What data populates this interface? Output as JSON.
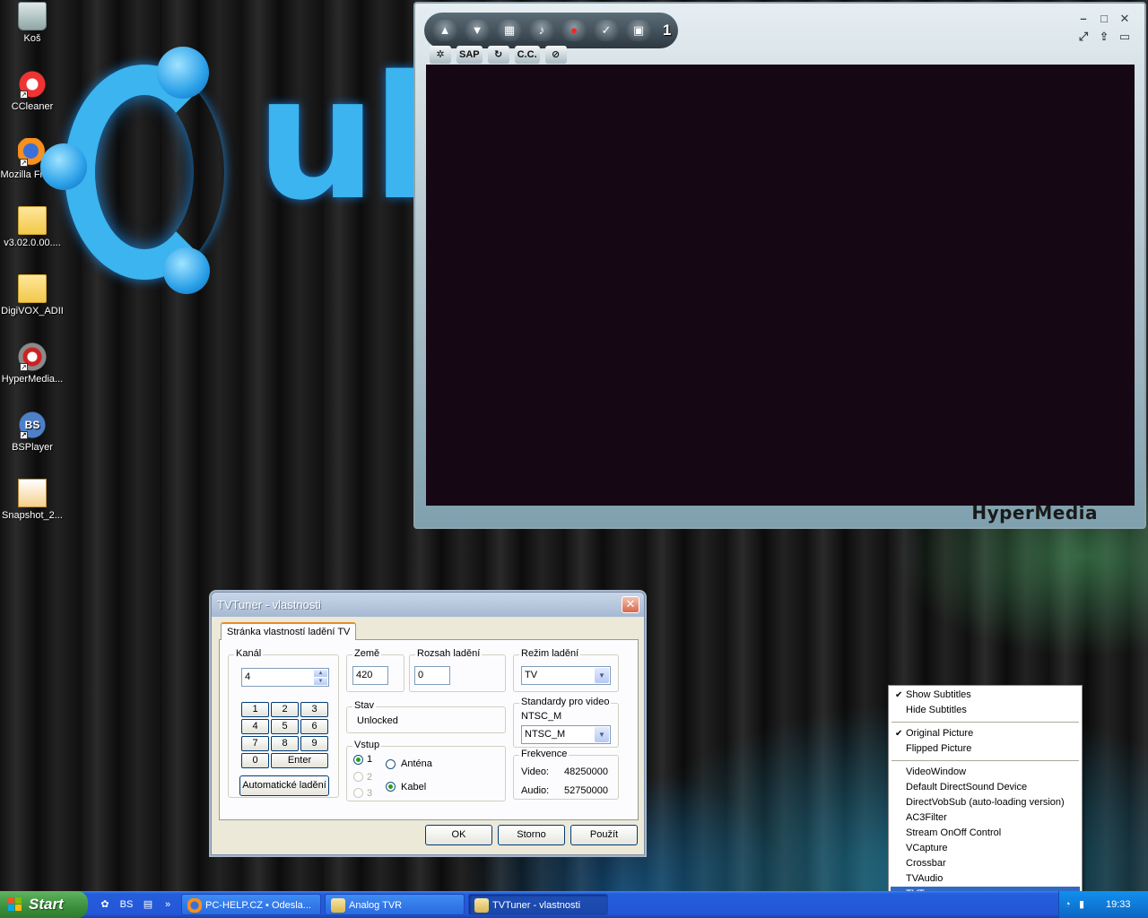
{
  "desktop": {
    "icons": [
      {
        "label": "Koš",
        "icon": "recycle-bin-icon"
      },
      {
        "label": "CCleaner",
        "icon": "ccleaner-icon"
      },
      {
        "label": "Mozilla Firefox",
        "icon": "firefox-icon"
      },
      {
        "label": "v3.02.0.00....",
        "icon": "folder-icon"
      },
      {
        "label": "DigiVOX_ADII",
        "icon": "folder-icon"
      },
      {
        "label": "HyperMedia...",
        "icon": "hypermedia-icon"
      },
      {
        "label": "BSPlayer",
        "icon": "bsplayer-icon"
      },
      {
        "label": "Snapshot_2...",
        "icon": "snapshot-image-icon"
      }
    ],
    "wallpaper_text": "ub"
  },
  "player": {
    "channel": "1",
    "toolbar": [
      "channel-up-icon",
      "channel-down-icon",
      "grid-icon",
      "volume-icon",
      "record-icon",
      "schedule-icon",
      "snapshot-icon"
    ],
    "toolbar2": {
      "settings": "settings-icon",
      "sap": "SAP",
      "refresh": "refresh-icon",
      "cc": "C.C.",
      "mute": "mute-icon"
    },
    "brand": "HyperMedia",
    "video_bg": "#150713"
  },
  "dialog": {
    "title": "TVTuner - vlastnosti",
    "tab": "Stránka vlastností ladění TV",
    "kanal": {
      "label": "Kanál",
      "value": "4"
    },
    "keypad": [
      "1",
      "2",
      "3",
      "4",
      "5",
      "6",
      "7",
      "8",
      "9",
      "0",
      "Enter"
    ],
    "auto_tune": "Automatické ladění",
    "zeme": {
      "label": "Země",
      "value": "420"
    },
    "rozsah": {
      "label": "Rozsah ladění",
      "value": "0"
    },
    "rezim": {
      "label": "Režim ladění",
      "value": "TV"
    },
    "stav": {
      "label": "Stav",
      "value": "Unlocked"
    },
    "vstup": {
      "label": "Vstup",
      "numbers": [
        "1",
        "2",
        "3"
      ],
      "antena": "Anténa",
      "kabel": "Kabel"
    },
    "standardy": {
      "label": "Standardy pro video",
      "current": "NTSC_M",
      "value": "NTSC_M"
    },
    "frekvence": {
      "label": "Frekvence",
      "video_label": "Video:",
      "video_value": "48250000",
      "audio_label": "Audio:",
      "audio_value": "52750000"
    },
    "buttons": {
      "ok": "OK",
      "cancel": "Storno",
      "apply": "Použít"
    }
  },
  "context_menu": {
    "items": [
      {
        "label": "Show Subtitles",
        "checked": true
      },
      {
        "label": "Hide Subtitles",
        "checked": false
      },
      {
        "separator": true
      },
      {
        "label": "Original Picture",
        "checked": true
      },
      {
        "label": "Flipped Picture",
        "checked": false
      },
      {
        "separator": true
      },
      {
        "label": "VideoWindow",
        "checked": false
      },
      {
        "label": "Default DirectSound Device",
        "checked": false
      },
      {
        "label": "DirectVobSub (auto-loading version)",
        "checked": false
      },
      {
        "label": "AC3Filter",
        "checked": false
      },
      {
        "label": "Stream OnOff Control",
        "checked": false
      },
      {
        "label": "VCapture",
        "checked": false
      },
      {
        "label": "Crossbar",
        "checked": false
      },
      {
        "label": "TVAudio",
        "checked": false
      },
      {
        "label": "TVTuner",
        "checked": false,
        "selected": true
      }
    ]
  },
  "taskbar": {
    "start": "Start",
    "quick_launch": [
      "hypermedia-icon",
      "bsplayer-icon",
      "clapboard-icon"
    ],
    "overflow": "»",
    "tasks": [
      {
        "label": "PC-HELP.CZ • Odesla...",
        "icon": "firefox-icon",
        "active": false
      },
      {
        "label": "Analog TVR",
        "icon": "tv-icon",
        "active": false
      },
      {
        "label": "TVTuner - vlastnosti",
        "icon": "tv-icon",
        "active": true
      }
    ],
    "clock": "19:33"
  }
}
